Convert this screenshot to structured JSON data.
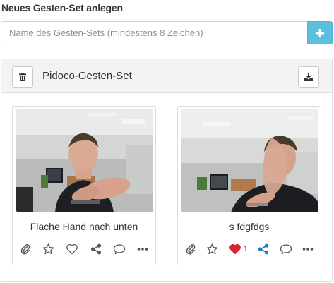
{
  "heading": "Neues Gesten-Set anlegen",
  "new_set": {
    "placeholder": "Name des Gesten-Sets (mindestens 8 Zeichen)",
    "add_icon": "plus-icon"
  },
  "gesture_set": {
    "title": "Pidoco-Gesten-Set",
    "delete_icon": "trash-icon",
    "download_icon": "download-icon",
    "gestures": [
      {
        "title": "Flache Hand nach unten",
        "liked": false,
        "like_count": "",
        "shared": false
      },
      {
        "title": "s fdgfdgs",
        "liked": true,
        "like_count": "1",
        "shared": true
      }
    ]
  },
  "colors": {
    "accent": "#5bc0de",
    "like": "#d9232e",
    "share": "#1f7bbf",
    "icon": "#555555"
  }
}
